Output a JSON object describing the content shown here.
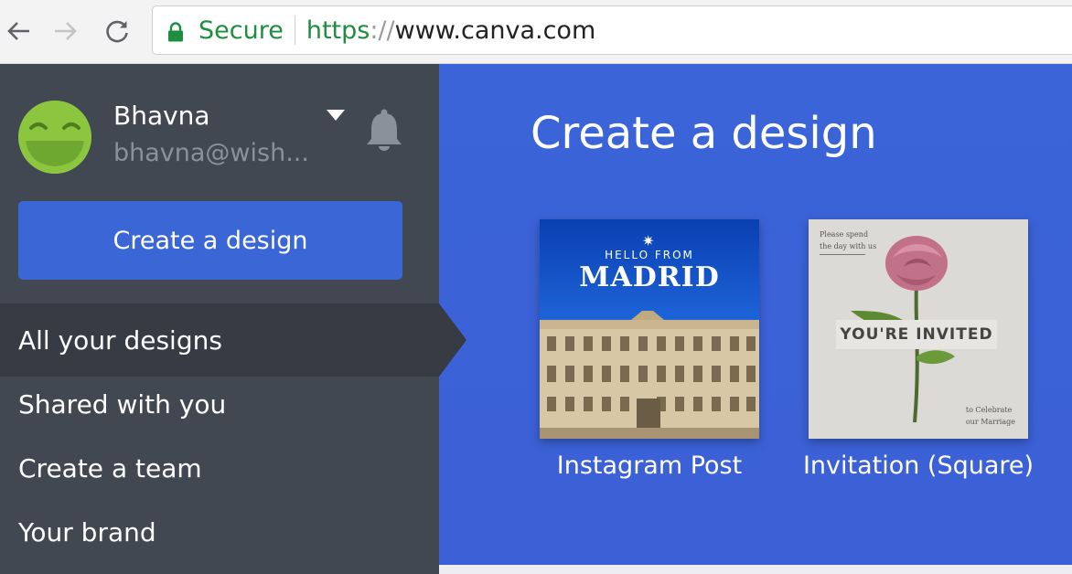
{
  "browser": {
    "security_label": "Secure",
    "url_scheme": "https",
    "url_separator": "://",
    "url_host": "www.canva.com",
    "icons": [
      "back-arrow-icon",
      "forward-arrow-icon",
      "reload-icon",
      "lock-icon"
    ]
  },
  "sidebar": {
    "user_name": "Bhavna",
    "user_email": "bhavna@wish...",
    "create_button_label": "Create a design",
    "nav_items": [
      {
        "label": "All your designs",
        "active": true
      },
      {
        "label": "Shared with you",
        "active": false
      },
      {
        "label": "Create a team",
        "active": false
      },
      {
        "label": "Your brand",
        "active": false
      }
    ],
    "icons": [
      "smiley-avatar-icon",
      "caret-down-icon",
      "bell-icon"
    ]
  },
  "main": {
    "title": "Create a design",
    "cards": [
      {
        "label": "Instagram Post",
        "thumb_text_top": "HELLO FROM",
        "thumb_text_main": "MADRID"
      },
      {
        "label": "Invitation (Square)",
        "thumb_text_top_1": "Please spend",
        "thumb_text_top_2": "the day with us",
        "thumb_text_main": "YOU'RE INVITED",
        "thumb_text_bottom_1": "to Celebrate",
        "thumb_text_bottom_2": "our Marriage"
      }
    ]
  },
  "colors": {
    "sidebar_bg": "#424852",
    "sidebar_active_bg": "#363b44",
    "main_bg": "#3b63d7",
    "primary_button": "#3b66d6",
    "secure_green": "#1e8e3e",
    "avatar_green": "#8cc63f"
  }
}
